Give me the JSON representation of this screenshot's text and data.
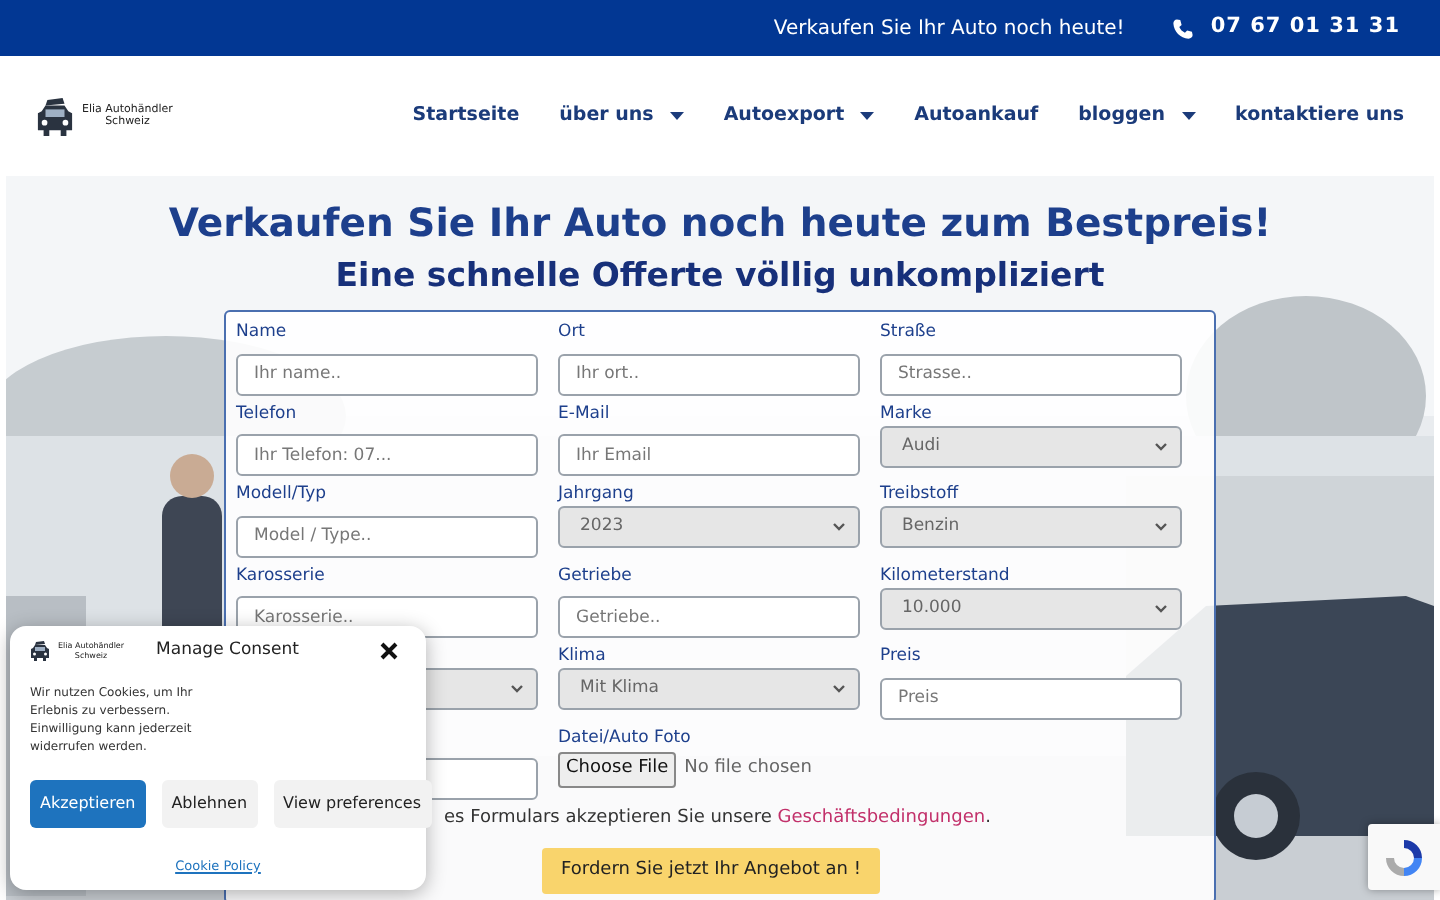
{
  "top_bar": {
    "slogan": "Verkaufen Sie Ihr Auto noch heute!",
    "phone": "07 67 01 31 31"
  },
  "logo": {
    "lines": [
      "Elia Autohändler",
      "Schweiz"
    ]
  },
  "nav": [
    {
      "label": "Startseite",
      "dropdown": false
    },
    {
      "label": "über uns",
      "dropdown": true
    },
    {
      "label": "Autoexport",
      "dropdown": true
    },
    {
      "label": "Autoankauf",
      "dropdown": false
    },
    {
      "label": "bloggen",
      "dropdown": true
    },
    {
      "label": "kontaktiere uns",
      "dropdown": false
    }
  ],
  "hero": {
    "kind": "picture",
    "title": "Verkaufen Sie Ihr Auto noch heute zum Bestpreis!",
    "subtitle": "Eine schnelle Offerte völlig unkompliziert"
  },
  "form": {
    "fields": [
      {
        "kind": "input",
        "label": "Name",
        "placeholder": "Ihr name.."
      },
      {
        "kind": "input",
        "label": "Ort",
        "placeholder": "Ihr ort.."
      },
      {
        "kind": "input",
        "label": "Straße",
        "placeholder": "Strasse.."
      },
      {
        "kind": "input",
        "label": "Telefon",
        "placeholder": "Ihr Telefon: 07..."
      },
      {
        "kind": "input",
        "label": "E-Mail",
        "placeholder": "Ihr Email"
      },
      {
        "kind": "select",
        "label": "Marke",
        "value": "Audi"
      },
      {
        "kind": "input",
        "label": "Modell/Typ",
        "placeholder": "Model / Type.."
      },
      {
        "kind": "select",
        "label": "Jahrgang",
        "value": "2023"
      },
      {
        "kind": "select",
        "label": "Treibstoff",
        "value": "Benzin"
      },
      {
        "kind": "input",
        "label": "Karosserie",
        "placeholder": "Karosserie.."
      },
      {
        "kind": "input",
        "label": "Getriebe",
        "placeholder": "Getriebe.."
      },
      {
        "kind": "select",
        "label": "Kilometerstand",
        "value": "10.000"
      },
      {
        "kind": "select"
      },
      {
        "kind": "select",
        "label": "Klima",
        "value": "Mit Klima"
      },
      {
        "kind": "input",
        "label": "Preis",
        "placeholder": "Preis"
      },
      {
        "kind": "input"
      },
      {
        "kind": "file",
        "label": "Datei/Auto Foto",
        "button": "Choose File",
        "status": "No file chosen"
      }
    ],
    "terms": {
      "text": "es Formulars akzeptieren Sie unsere ",
      "link": "Geschäftsbedingungen",
      "end": "."
    },
    "submit": "Fordern Sie jetzt Ihr Angebot an !"
  },
  "consent": {
    "logo_lines": [
      "Elia Autohändler",
      "Schweiz"
    ],
    "title": "Manage Consent",
    "text": "Wir nutzen Cookies, um Ihr Erlebnis zu verbessern. Einwilligung kann jederzeit widerrufen werden.",
    "buttons": [
      {
        "label": "Akzeptieren",
        "primary": true
      },
      {
        "label": "Ablehnen",
        "primary": false
      },
      {
        "label": "View preferences",
        "primary": false
      }
    ],
    "link": "Cookie Policy"
  }
}
